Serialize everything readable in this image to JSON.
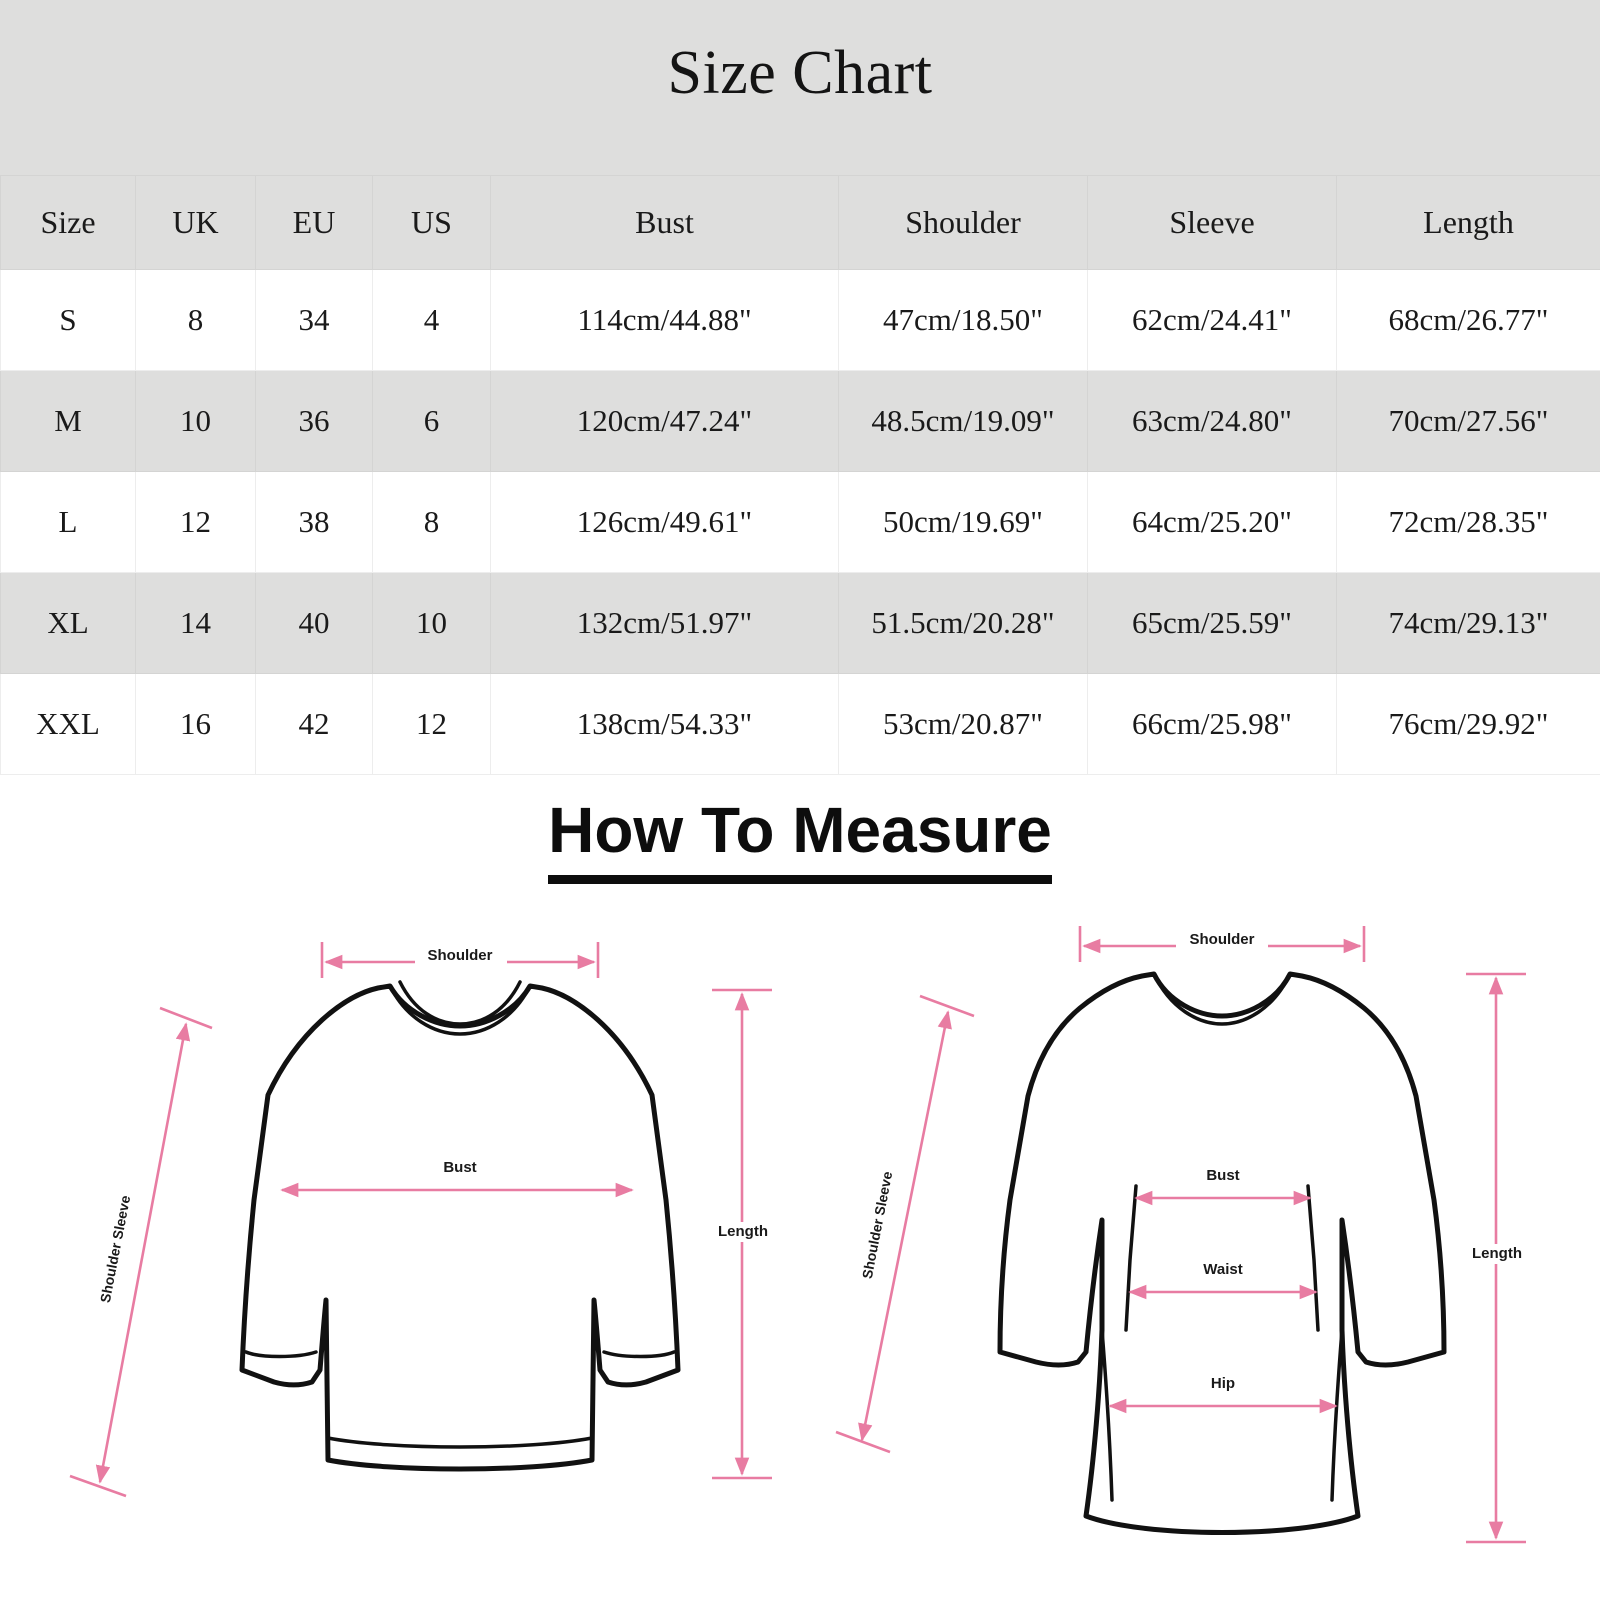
{
  "header": {
    "title": "Size Chart"
  },
  "size_table": {
    "columns": [
      "Size",
      "UK",
      "EU",
      "US",
      "Bust",
      "Shoulder",
      "Sleeve",
      "Length"
    ],
    "rows": [
      {
        "size": "S",
        "uk": "8",
        "eu": "34",
        "us": "4",
        "bust": "114cm/44.88\"",
        "shoulder": "47cm/18.50\"",
        "sleeve": "62cm/24.41\"",
        "length": "68cm/26.77\""
      },
      {
        "size": "M",
        "uk": "10",
        "eu": "36",
        "us": "6",
        "bust": "120cm/47.24\"",
        "shoulder": "48.5cm/19.09\"",
        "sleeve": "63cm/24.80\"",
        "length": "70cm/27.56\""
      },
      {
        "size": "L",
        "uk": "12",
        "eu": "38",
        "us": "8",
        "bust": "126cm/49.61\"",
        "shoulder": "50cm/19.69\"",
        "sleeve": "64cm/25.20\"",
        "length": "72cm/28.35\""
      },
      {
        "size": "XL",
        "uk": "14",
        "eu": "40",
        "us": "10",
        "bust": "132cm/51.97\"",
        "shoulder": "51.5cm/20.28\"",
        "sleeve": "65cm/25.59\"",
        "length": "74cm/29.13\""
      },
      {
        "size": "XXL",
        "uk": "16",
        "eu": "42",
        "us": "12",
        "bust": "138cm/54.33\"",
        "shoulder": "53cm/20.87\"",
        "sleeve": "66cm/25.98\"",
        "length": "76cm/29.92\""
      }
    ]
  },
  "how_to_measure": {
    "heading": "How To Measure",
    "sweatshirt_diagram": {
      "labels": {
        "shoulder": "Shoulder",
        "bust": "Bust",
        "length": "Length",
        "shoulder_sleeve": "Shoulder Sleeve"
      }
    },
    "dress_diagram": {
      "labels": {
        "shoulder": "Shoulder",
        "bust": "Bust",
        "waist": "Waist",
        "hip": "Hip",
        "length": "Length",
        "shoulder_sleeve": "Shoulder Sleeve"
      }
    }
  },
  "colors": {
    "banner_bg": "#dededd",
    "row_shaded_bg": "#dededd",
    "row_plain_bg": "#ffffff",
    "measure_arrow": "#e87ca2",
    "garment_outline": "#111111",
    "text": "#1a1a1a"
  }
}
